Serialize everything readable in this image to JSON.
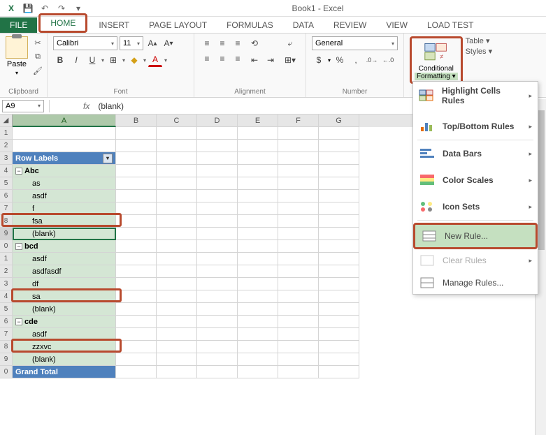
{
  "title": "Book1 - Excel",
  "qat": {
    "save": "💾",
    "undo": "↶",
    "redo": "↷",
    "more": "▾"
  },
  "tabs": [
    "FILE",
    "HOME",
    "INSERT",
    "PAGE LAYOUT",
    "FORMULAS",
    "DATA",
    "REVIEW",
    "VIEW",
    "LOAD TEST"
  ],
  "active_tab": "HOME",
  "ribbon": {
    "clipboard": {
      "paste": "Paste",
      "label": "Clipboard"
    },
    "font": {
      "name": "Calibri",
      "size": "11",
      "inc": "A▴",
      "dec": "A▾",
      "bold": "B",
      "italic": "I",
      "underline": "U",
      "border": "⊞",
      "fill": "◆",
      "color": "A",
      "label": "Font"
    },
    "alignment": {
      "label": "Alignment",
      "wrap": "⇥",
      "merge": "⊞"
    },
    "number": {
      "format": "General",
      "label": "Number",
      "currency": "$",
      "percent": "%",
      "comma": ",",
      "inc": ".0→",
      "dec": "←.0"
    },
    "styles": {
      "cond": "Conditional",
      "cond2": "Formatting ▾",
      "table": "Table ▾",
      "styles": "Styles ▾"
    }
  },
  "menu": {
    "highlight": "Highlight Cells Rules",
    "topbottom": "Top/Bottom Rules",
    "databars": "Data Bars",
    "colorscales": "Color Scales",
    "iconsets": "Icon Sets",
    "newrule": "New Rule...",
    "clear": "Clear Rules",
    "manage": "Manage Rules..."
  },
  "namebox": "A9",
  "formula": "(blank)",
  "cols": [
    "A",
    "B",
    "C",
    "D",
    "E",
    "F",
    "G"
  ],
  "row_labels_header": "Row Labels",
  "rows": [
    {
      "n": 1,
      "t": "",
      "cls": ""
    },
    {
      "n": 2,
      "t": "",
      "cls": ""
    },
    {
      "n": 3,
      "t": "Row Labels",
      "cls": "rowlabels"
    },
    {
      "n": 4,
      "t": "Abc",
      "cls": "grp"
    },
    {
      "n": 5,
      "t": "as",
      "cls": "item"
    },
    {
      "n": 6,
      "t": "asdf",
      "cls": "item"
    },
    {
      "n": 7,
      "t": "f",
      "cls": "item"
    },
    {
      "n": 8,
      "t": "fsa",
      "cls": "item"
    },
    {
      "n": 9,
      "t": "(blank)",
      "cls": "item"
    },
    {
      "n": 0,
      "t": "bcd",
      "cls": "grp"
    },
    {
      "n": 1,
      "t": "asdf",
      "cls": "item"
    },
    {
      "n": 2,
      "t": "asdfasdf",
      "cls": "item"
    },
    {
      "n": 3,
      "t": "df",
      "cls": "item"
    },
    {
      "n": 4,
      "t": "sa",
      "cls": "item"
    },
    {
      "n": 5,
      "t": "(blank)",
      "cls": "item"
    },
    {
      "n": 6,
      "t": "cde",
      "cls": "grp"
    },
    {
      "n": 7,
      "t": "asdf",
      "cls": "item"
    },
    {
      "n": 8,
      "t": "zzxvc",
      "cls": "item"
    },
    {
      "n": 9,
      "t": "(blank)",
      "cls": "item"
    },
    {
      "n": 0,
      "t": "Grand Total",
      "cls": "total"
    }
  ]
}
